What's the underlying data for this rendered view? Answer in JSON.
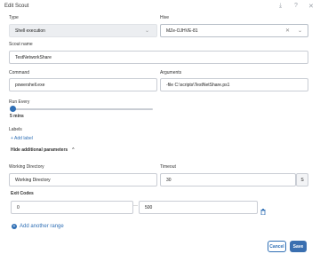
{
  "dialog": {
    "title": "Edit Scout"
  },
  "type": {
    "label": "Type",
    "value": "Shell execution"
  },
  "hive": {
    "label": "Hive",
    "value": "MZe-OJHVE-81"
  },
  "scout_name": {
    "label": "Scout name",
    "value": "TestNetworkShare"
  },
  "command": {
    "label": "Command",
    "value": "powershell.exe"
  },
  "arguments": {
    "label": "Arguments",
    "value": "-file C:\\scripts\\TestNetShare.ps1"
  },
  "run_every": {
    "label": "Run Every",
    "value_text": "5 mins",
    "slider_fraction": 0.0
  },
  "labels": {
    "label": "Labels",
    "add_label": "+ Add label"
  },
  "additional": {
    "toggle_label": "Hide additional parameters"
  },
  "working_directory": {
    "label": "Working Directory",
    "value": "Working Directory"
  },
  "timeout": {
    "label": "Timeout",
    "value": "30",
    "unit": "S"
  },
  "exit_codes": {
    "label": "Exit Codes",
    "from": "0",
    "separator": "—",
    "to": "500"
  },
  "add_range": {
    "label": "Add another range"
  },
  "footer": {
    "cancel": "Cancel",
    "save": "Save"
  },
  "colors": {
    "accent": "#2f6fb5",
    "save_bg": "#3a6fb0"
  }
}
